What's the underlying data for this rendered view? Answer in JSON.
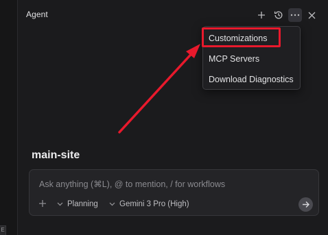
{
  "header": {
    "title": "Agent",
    "icons": [
      "plus-icon",
      "history-icon",
      "more-icon",
      "close-icon"
    ]
  },
  "menu": {
    "items": [
      {
        "label": "Customizations",
        "highlighted": true
      },
      {
        "label": "MCP Servers"
      },
      {
        "label": "Download Diagnostics"
      }
    ]
  },
  "annotation": {
    "color": "#e8192c",
    "shape": "arrow pointing to highlighted menu item"
  },
  "workspace": {
    "title": "main-site"
  },
  "composer": {
    "placeholder": "Ask anything (⌘L), @ to mention, / for workflows",
    "mode_label": "Planning",
    "model_label": "Gemini 3 Pro (High)"
  },
  "left_strip": {
    "tag": "E"
  },
  "colors": {
    "background": "#1b1b1d",
    "menu_background": "#1f1f22",
    "annotation_red": "#e8192c"
  }
}
